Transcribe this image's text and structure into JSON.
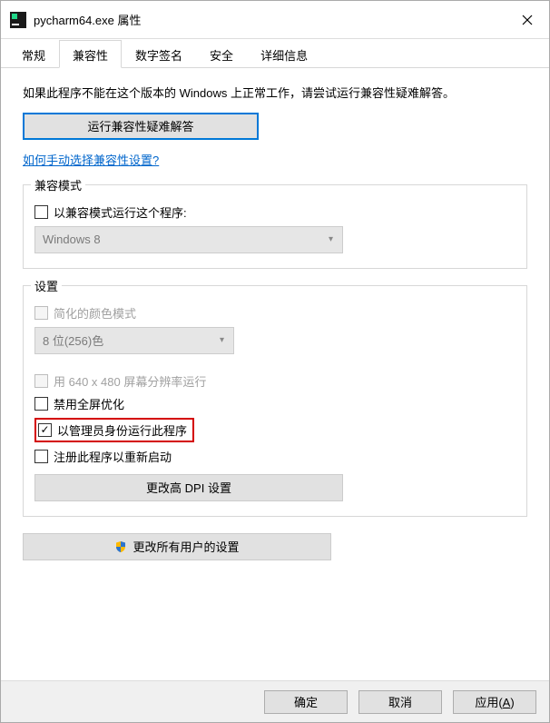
{
  "titlebar": {
    "title": "pycharm64.exe 属性"
  },
  "tabs": {
    "general": "常规",
    "compat": "兼容性",
    "sig": "数字签名",
    "security": "安全",
    "details": "详细信息"
  },
  "body": {
    "description": "如果此程序不能在这个版本的 Windows 上正常工作，请尝试运行兼容性疑难解答。",
    "troubleshoot_btn": "运行兼容性疑难解答",
    "manual_link": "如何手动选择兼容性设置?"
  },
  "compat_mode": {
    "legend": "兼容模式",
    "checkbox_label": "以兼容模式运行这个程序:",
    "combo_value": "Windows 8"
  },
  "settings": {
    "legend": "设置",
    "reduced_color": "简化的颜色模式",
    "color_combo": "8 位(256)色",
    "lowres": "用 640 x 480 屏幕分辨率运行",
    "disable_fullscreen": "禁用全屏优化",
    "run_admin": "以管理员身份运行此程序",
    "register_restart": "注册此程序以重新启动",
    "dpi_btn": "更改高 DPI 设置"
  },
  "change_all_btn": "更改所有用户的设置",
  "footer": {
    "ok": "确定",
    "cancel": "取消",
    "apply_pre": "应用(",
    "apply_key": "A",
    "apply_post": ")"
  }
}
